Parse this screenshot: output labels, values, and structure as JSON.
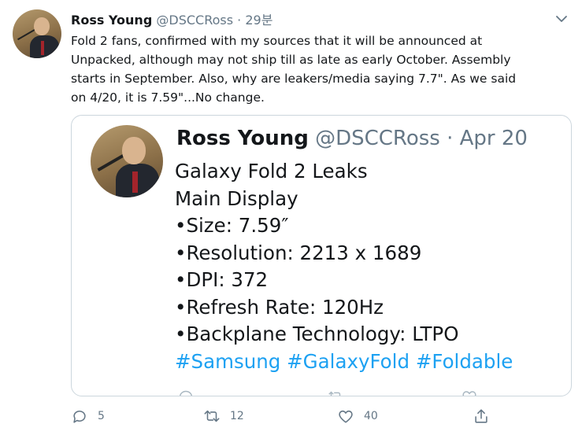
{
  "tweet": {
    "author_name": "Ross Young",
    "handle": "@DSCCRoss",
    "separator": "·",
    "time": "29분",
    "text_lines": [
      "Fold 2 fans, confirmed with my sources that it will be announced at",
      "Unpacked, although may not ship till as late as early October. Assembly",
      "starts in September. Also, why are leakers/media saying 7.7\". As we said",
      "on 4/20, it is 7.59\"...No change."
    ]
  },
  "quoted_tweet": {
    "author_name": "Ross Young",
    "handle": "@DSCCRoss",
    "separator": "·",
    "date": "Apr 20",
    "lines": [
      "Galaxy Fold 2 Leaks",
      "Main Display",
      "•Size: 7.59″",
      "•Resolution: 2213 x 1689",
      "•DPI: 372",
      "•Refresh Rate: 120Hz",
      "•Backplane Technology: LTPO"
    ],
    "hashtags": "#Samsung #GalaxyFold #Foldable"
  },
  "actions": {
    "reply_count": "5",
    "retweet_count": "12",
    "like_count": "40"
  },
  "colors": {
    "text": "#14171a",
    "muted": "#657786",
    "link": "#1da1f2",
    "border": "#ccd6dd"
  },
  "icons": [
    "chevron-down-icon",
    "reply-icon",
    "retweet-icon",
    "like-icon",
    "share-icon"
  ]
}
